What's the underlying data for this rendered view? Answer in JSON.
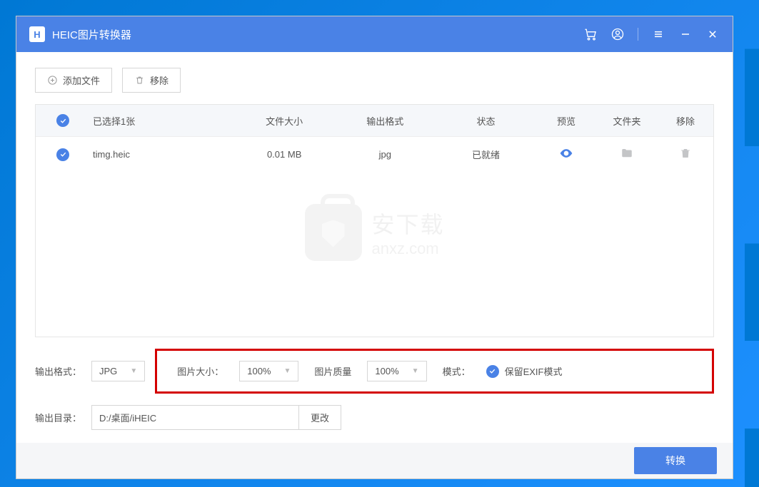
{
  "titlebar": {
    "logo_letter": "H",
    "title": "HEIC图片转换器"
  },
  "toolbar": {
    "add_file": "添加文件",
    "remove": "移除"
  },
  "table": {
    "headers": {
      "selected": "已选择1张",
      "size": "文件大小",
      "format": "输出格式",
      "status": "状态",
      "preview": "预览",
      "folder": "文件夹",
      "remove": "移除"
    },
    "rows": [
      {
        "name": "timg.heic",
        "size": "0.01 MB",
        "format": "jpg",
        "status": "已就绪"
      }
    ]
  },
  "watermark": {
    "cn": "安下载",
    "en": "anxz.com"
  },
  "settings": {
    "output_format_label": "输出格式：",
    "output_format_value": "JPG",
    "image_size_label": "图片大小：",
    "image_size_value": "100%",
    "image_quality_label": "图片质量",
    "image_quality_value": "100%",
    "mode_label": "模式：",
    "exif_label": "保留EXIF模式"
  },
  "output": {
    "label": "输出目录：",
    "path": "D:/桌面/iHEIC",
    "change": "更改"
  },
  "footer": {
    "convert": "转换"
  }
}
